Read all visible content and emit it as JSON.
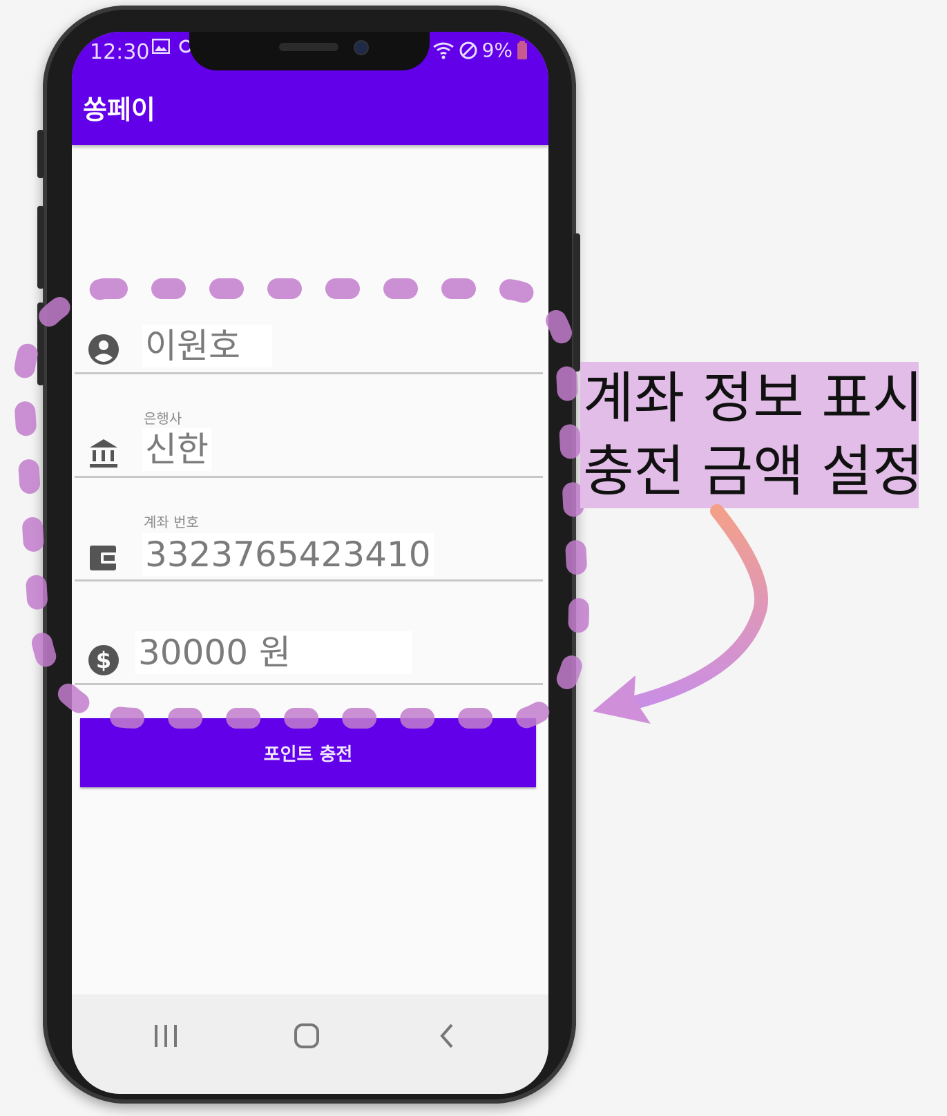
{
  "status_bar": {
    "time": "12:30",
    "battery": "9%"
  },
  "app_bar": {
    "title": "쏭페이"
  },
  "form": {
    "name": {
      "value": "이원호"
    },
    "bank": {
      "label": "은행사",
      "value": "신한"
    },
    "account": {
      "label": "계좌 번호",
      "value": "3323765423410"
    },
    "amount": {
      "value": "30000 원"
    }
  },
  "charge_button": {
    "label": "포인트 충전"
  },
  "annotation": {
    "line1": "계좌 정보 표시",
    "line2": "충전 금액 설정"
  },
  "colors": {
    "primary": "#6200ea",
    "highlight": "#e2bde8",
    "dash": "#c27ccd"
  },
  "icons": [
    "account-circle-icon",
    "bank-icon",
    "wallet-icon",
    "dollar-icon",
    "recent-apps-icon",
    "home-icon",
    "back-icon",
    "image-icon",
    "wifi-icon",
    "dnd-icon",
    "battery-icon"
  ]
}
